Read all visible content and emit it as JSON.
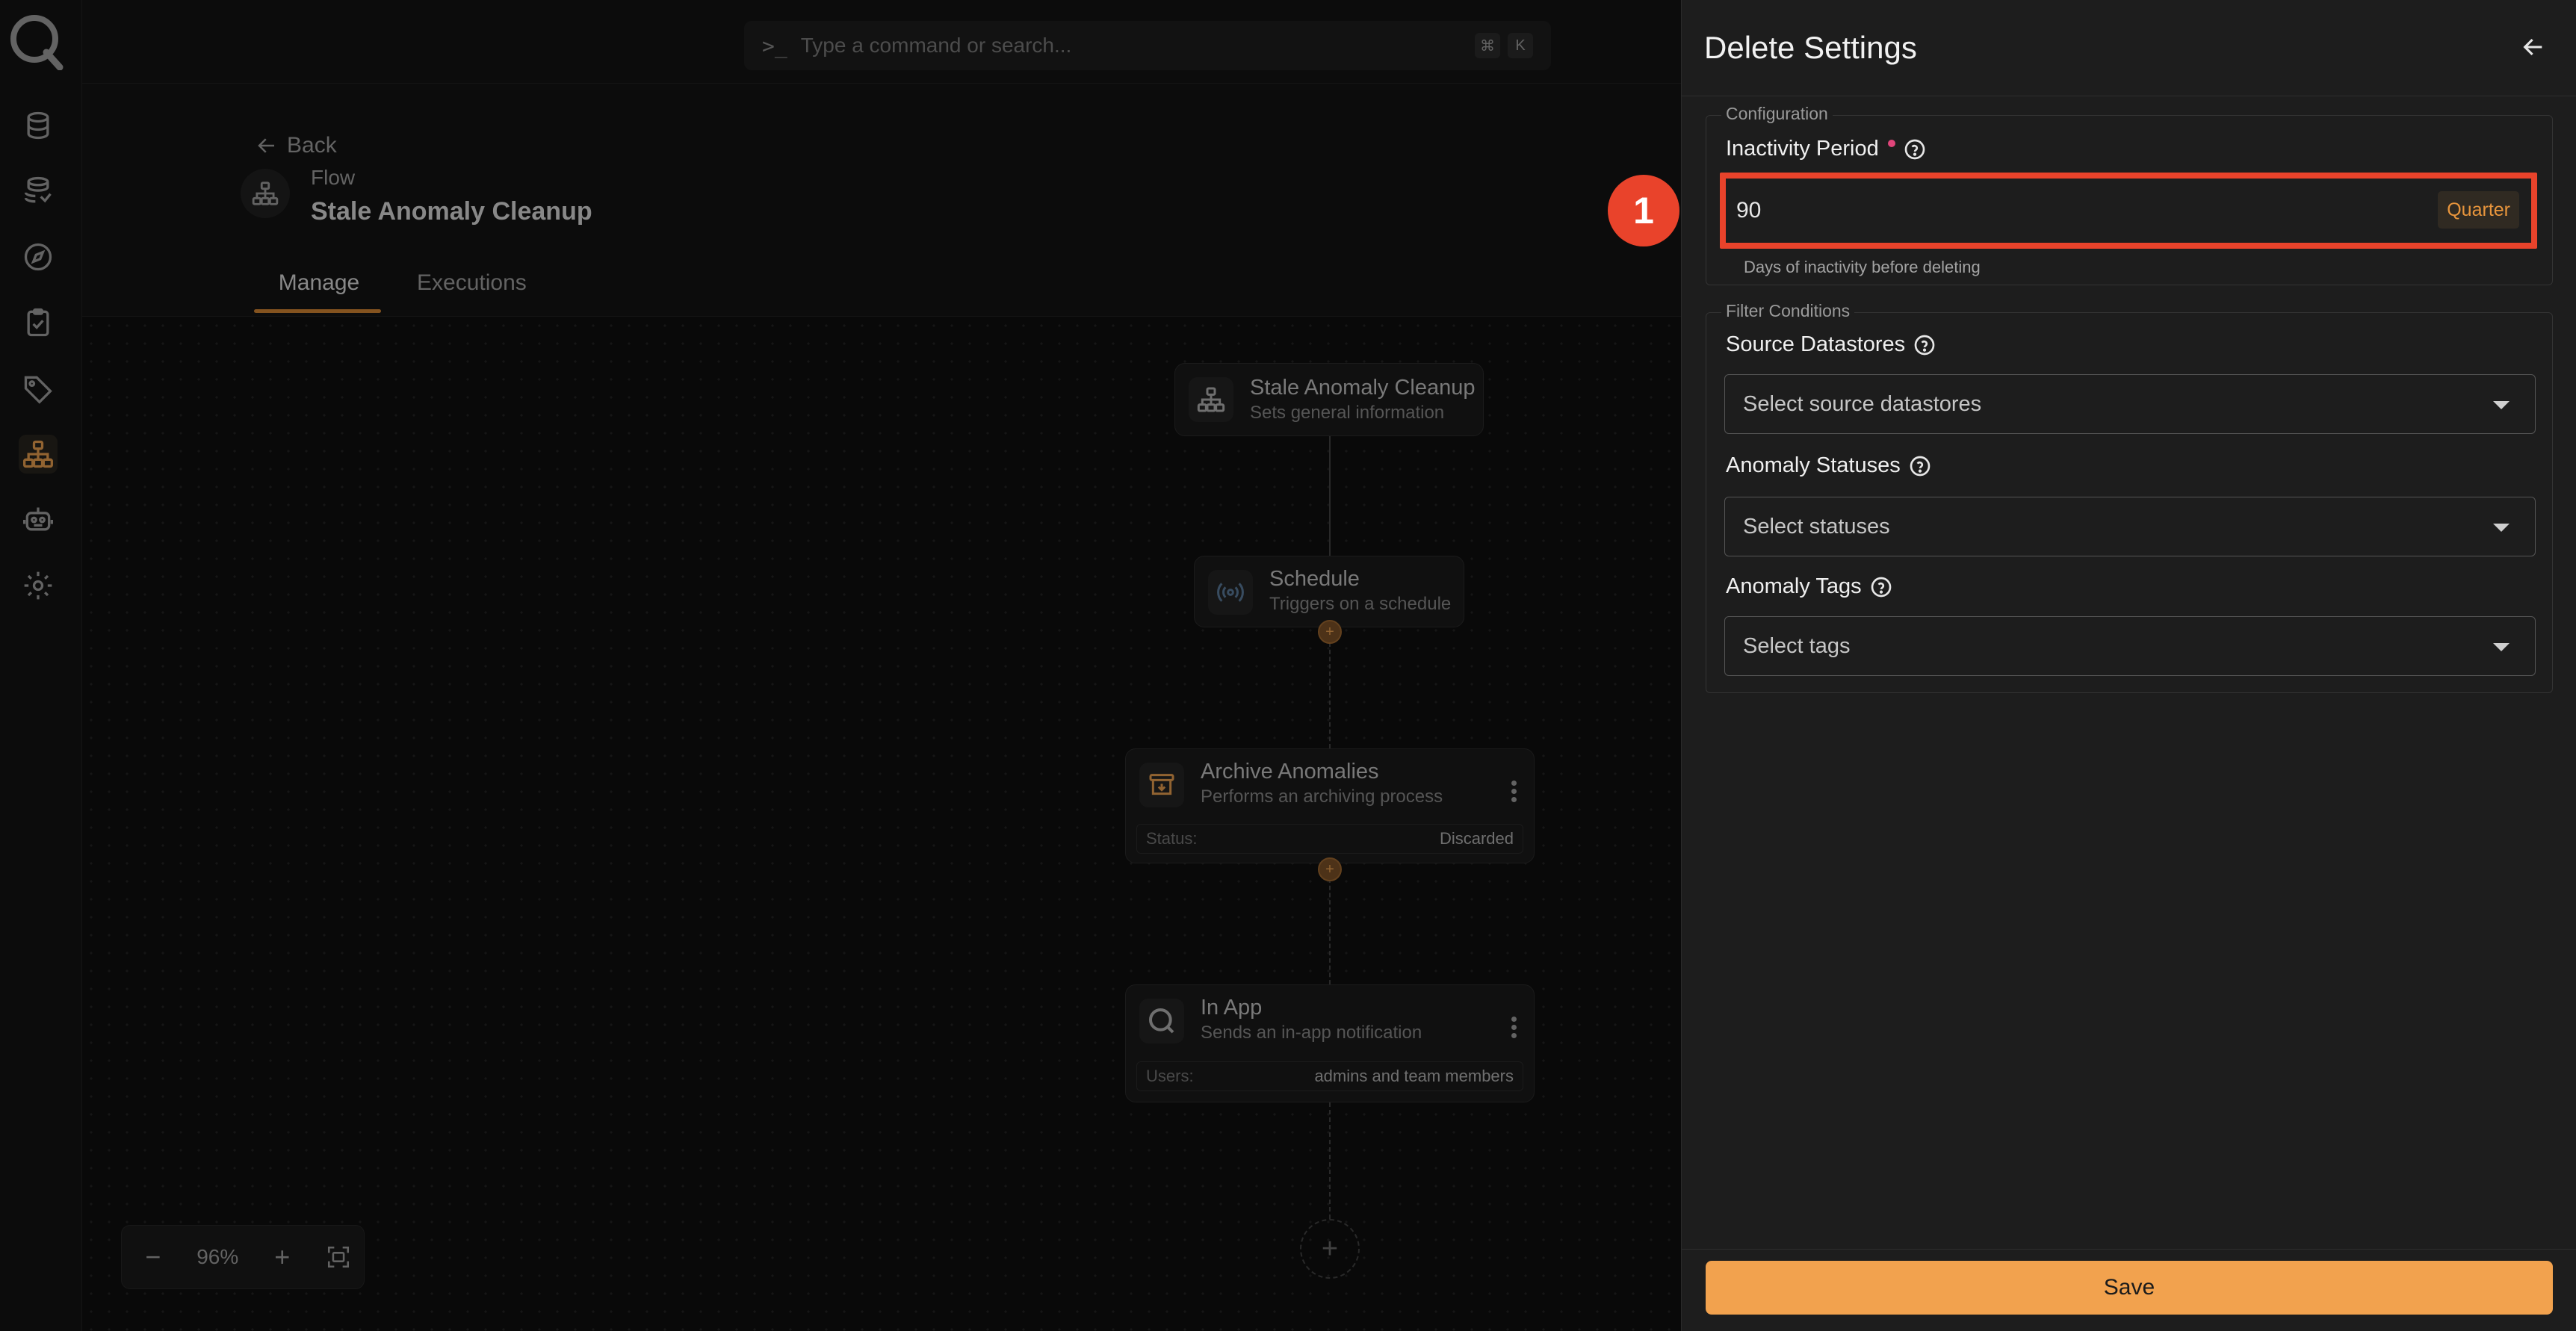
{
  "command_bar": {
    "prompt": ">_",
    "placeholder": "Type a command or search...",
    "shortcut_mod": "⌘",
    "shortcut_key": "K"
  },
  "header": {
    "back_label": "Back",
    "flow_kicker": "Flow",
    "flow_title": "Stale Anomaly Cleanup",
    "tabs": [
      {
        "label": "Manage",
        "active": true
      },
      {
        "label": "Executions",
        "active": false
      }
    ]
  },
  "nodes": {
    "flow": {
      "title": "Stale Anomaly Cleanup",
      "subtitle": "Sets general information"
    },
    "schedule": {
      "title": "Schedule",
      "subtitle": "Triggers on a schedule"
    },
    "archive": {
      "title": "Archive Anomalies",
      "subtitle": "Performs an archiving process",
      "row_key": "Status:",
      "row_value": "Discarded"
    },
    "in_app": {
      "title": "In App",
      "subtitle": "Sends an in-app notification",
      "row_key": "Users:",
      "row_value": "admins and team members"
    },
    "add_symbol": "+"
  },
  "zoom": {
    "minus": "−",
    "level": "96%",
    "plus": "+"
  },
  "step_badge": "1",
  "panel": {
    "title": "Delete Settings",
    "configuration": {
      "legend": "Configuration",
      "inactivity_label": "Inactivity Period",
      "inactivity_value": "90",
      "unit_chip": "Quarter",
      "hint": "Days of inactivity before deleting"
    },
    "filters": {
      "legend": "Filter Conditions",
      "source_label": "Source Datastores",
      "source_placeholder": "Select source datastores",
      "status_label": "Anomaly Statuses",
      "status_placeholder": "Select statuses",
      "tags_label": "Anomaly Tags",
      "tags_placeholder": "Select tags"
    },
    "save_label": "Save"
  },
  "colors": {
    "accent": "#f2a24e",
    "highlight": "#e9432b",
    "required_dot": "#e0457a",
    "active_tab": "#b8742c"
  },
  "icons": {
    "rail": [
      "datastore-icon",
      "datastore-stack-icon",
      "explore-icon",
      "checks-icon",
      "tag-icon",
      "flows-icon",
      "agent-icon",
      "settings-icon"
    ]
  }
}
